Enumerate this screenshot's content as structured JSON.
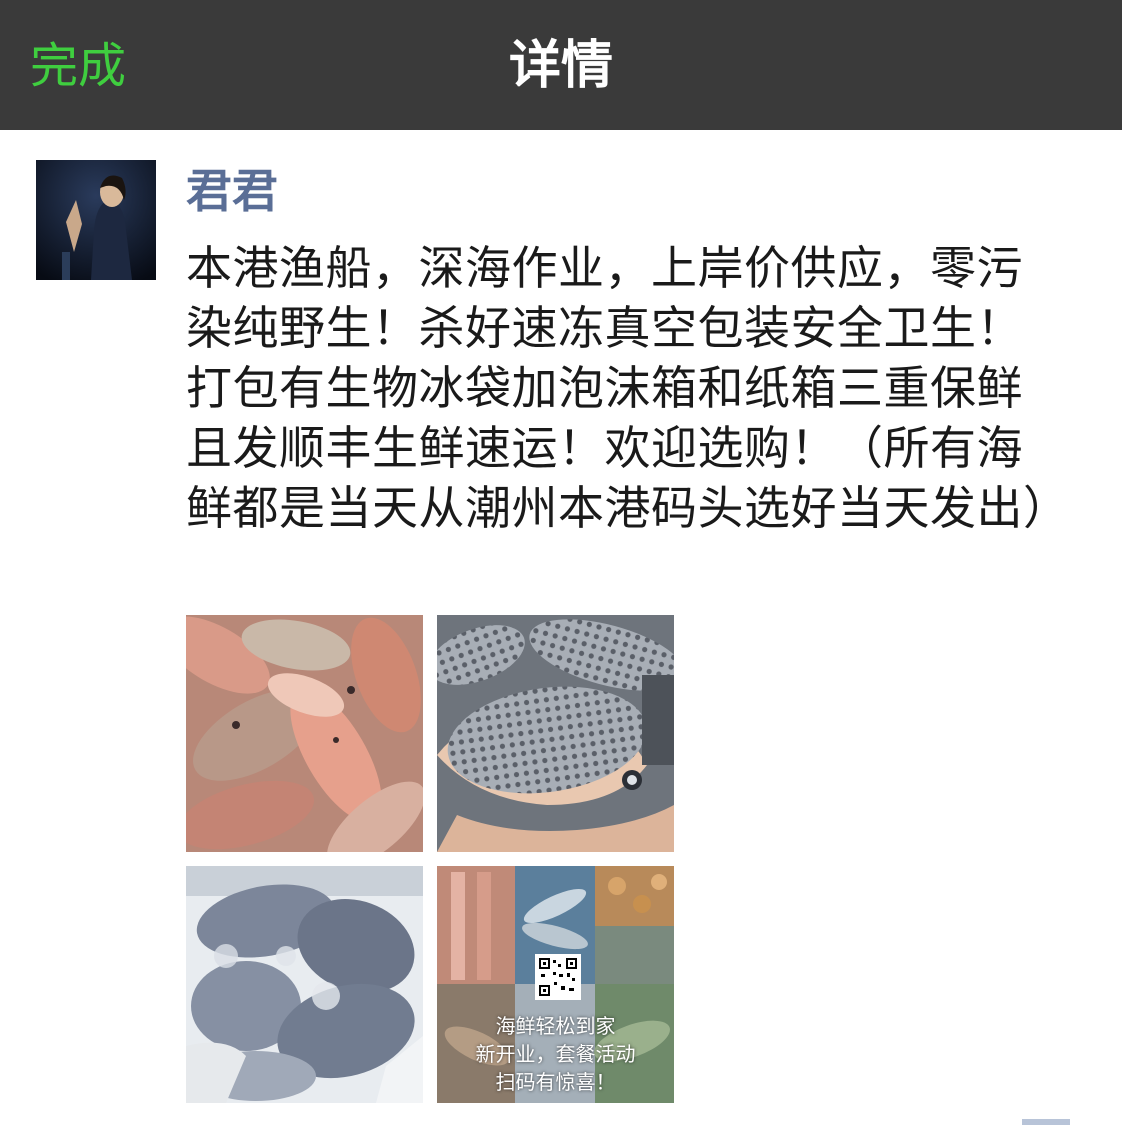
{
  "navbar": {
    "done_label": "完成",
    "title": "详情"
  },
  "post": {
    "username": "君君",
    "text": "本港渔船，深海作业，上岸价供应，零污染纯野生！杀好速冻真空包装安全卫生！打包有生物冰袋加泡沫箱和纸箱三重保鲜且发顺丰生鲜速运！欢迎选购！（所有海鲜都是当天从潮州本港码头选好当天发出）"
  },
  "photos": {
    "photo4_overlay": [
      "海鲜轻松到家",
      "新开业，套餐活动",
      "扫码有惊喜！"
    ]
  },
  "colors": {
    "navbar_bg": "#3a3a3a",
    "done_green": "#3fce3f",
    "username_blue": "#5a6e96"
  }
}
